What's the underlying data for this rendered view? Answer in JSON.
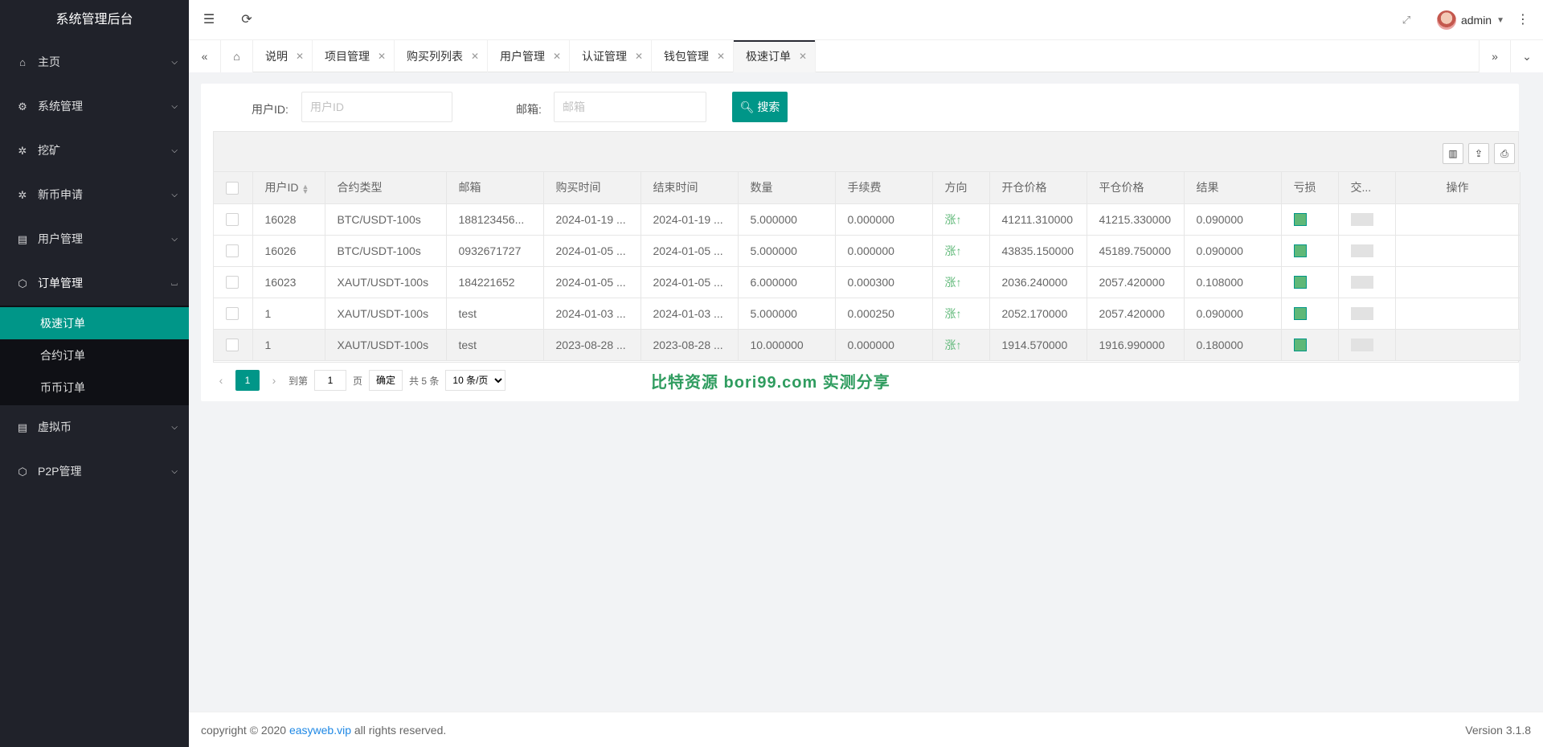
{
  "app": {
    "title": "系统管理后台"
  },
  "sidebar": {
    "items": [
      {
        "label": "主页",
        "icon": "home-icon"
      },
      {
        "label": "系统管理",
        "icon": "gear-icon"
      },
      {
        "label": "挖矿",
        "icon": "chip-icon"
      },
      {
        "label": "新币申请",
        "icon": "chip-icon"
      },
      {
        "label": "用户管理",
        "icon": "list-icon"
      },
      {
        "label": "订单管理",
        "icon": "cube-icon",
        "children": [
          "极速订单",
          "合约订单",
          "币币订单"
        ],
        "active_child": "极速订单"
      },
      {
        "label": "虚拟币",
        "icon": "list-icon"
      },
      {
        "label": "P2P管理",
        "icon": "cube-icon"
      }
    ]
  },
  "header": {
    "user": "admin"
  },
  "tabs": [
    {
      "label": "说明"
    },
    {
      "label": "项目管理"
    },
    {
      "label": "购买列列表"
    },
    {
      "label": "用户管理"
    },
    {
      "label": "认证管理"
    },
    {
      "label": "钱包管理"
    },
    {
      "label": "极速订单",
      "active": true
    }
  ],
  "search": {
    "user_id_label": "用户ID:",
    "user_id_placeholder": "用户ID",
    "email_label": "邮箱:",
    "email_placeholder": "邮箱",
    "button": "搜索"
  },
  "table": {
    "columns": [
      "用户ID",
      "合约类型",
      "邮箱",
      "购买时间",
      "结束时间",
      "数量",
      "手续费",
      "方向",
      "开仓价格",
      "平仓价格",
      "结果",
      "亏损",
      "交...",
      "操作"
    ],
    "rows": [
      {
        "id": "16028",
        "type": "BTC/USDT-100s",
        "email": "188123456...",
        "buy": "2024-01-19 ...",
        "end": "2024-01-19 ...",
        "qty": "5.000000",
        "fee": "0.000000",
        "dir": "涨↑",
        "open": "41211.310000",
        "close": "41215.330000",
        "result": "0.090000"
      },
      {
        "id": "16026",
        "type": "BTC/USDT-100s",
        "email": "0932671727",
        "buy": "2024-01-05 ...",
        "end": "2024-01-05 ...",
        "qty": "5.000000",
        "fee": "0.000000",
        "dir": "涨↑",
        "open": "43835.150000",
        "close": "45189.750000",
        "result": "0.090000"
      },
      {
        "id": "16023",
        "type": "XAUT/USDT-100s",
        "email": "184221652",
        "buy": "2024-01-05 ...",
        "end": "2024-01-05 ...",
        "qty": "6.000000",
        "fee": "0.000300",
        "dir": "涨↑",
        "open": "2036.240000",
        "close": "2057.420000",
        "result": "0.108000"
      },
      {
        "id": "1",
        "type": "XAUT/USDT-100s",
        "email": "test",
        "buy": "2024-01-03 ...",
        "end": "2024-01-03 ...",
        "qty": "5.000000",
        "fee": "0.000250",
        "dir": "涨↑",
        "open": "2052.170000",
        "close": "2057.420000",
        "result": "0.090000"
      },
      {
        "id": "1",
        "type": "XAUT/USDT-100s",
        "email": "test",
        "buy": "2023-08-28 ...",
        "end": "2023-08-28 ...",
        "qty": "10.000000",
        "fee": "0.000000",
        "dir": "涨↑",
        "open": "1914.570000",
        "close": "1916.990000",
        "result": "0.180000"
      }
    ]
  },
  "pager": {
    "current": "1",
    "goto_label": "到第",
    "goto_value": "1",
    "page_unit": "页",
    "confirm": "确定",
    "total": "共 5 条",
    "page_size": "10 条/页"
  },
  "watermark": "比特资源 bori99.com 实测分享",
  "footer": {
    "copyright_prefix": "copyright © 2020 ",
    "link": "easyweb.vip",
    "copyright_suffix": " all rights reserved.",
    "version": "Version 3.1.8"
  },
  "colors": {
    "accent": "#009688",
    "sidebar": "#20222a",
    "up": "#5FB878"
  }
}
